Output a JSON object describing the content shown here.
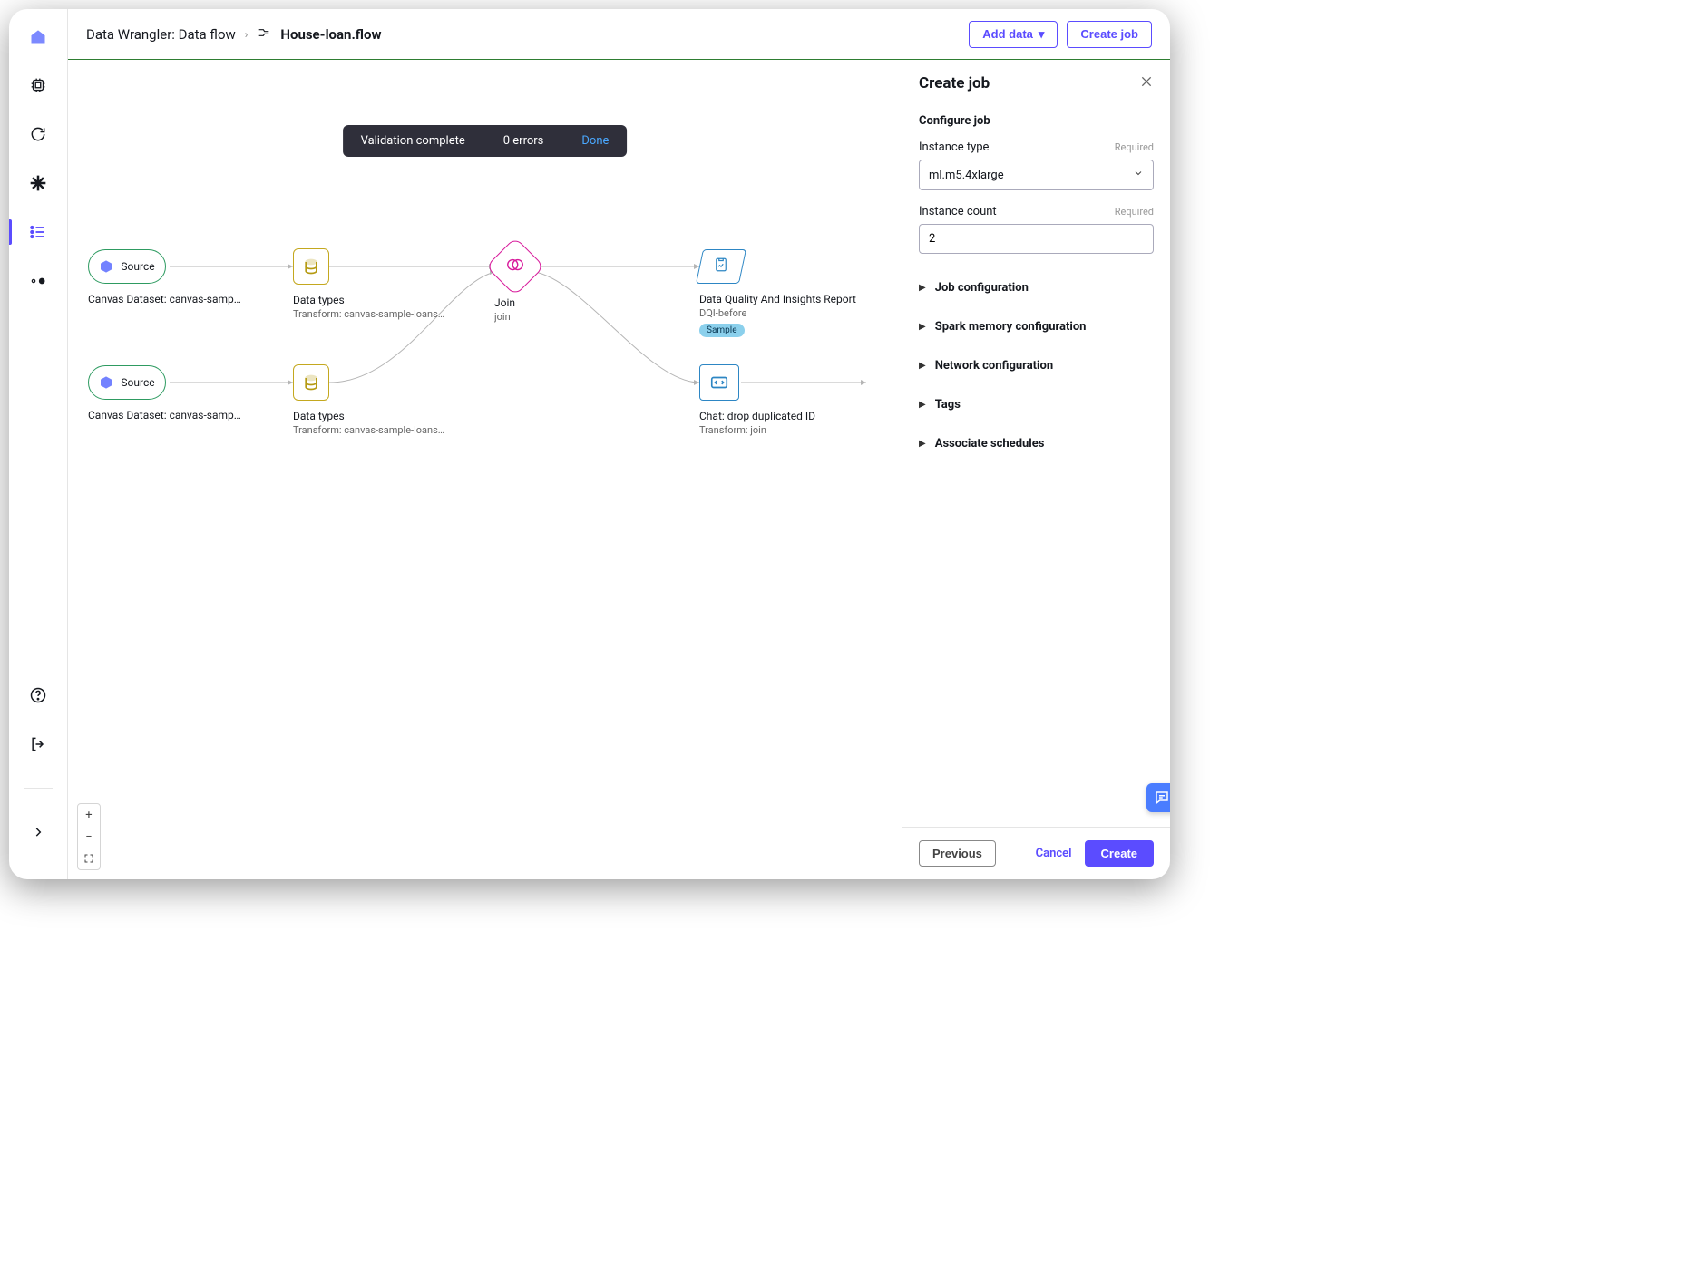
{
  "breadcrumb": {
    "root": "Data Wrangler: Data flow",
    "file": "House-loan.flow"
  },
  "topbar": {
    "add_data": "Add data",
    "create_job": "Create job"
  },
  "toast": {
    "message": "Validation complete",
    "errors": "0 errors",
    "done": "Done"
  },
  "nodes": {
    "source1": {
      "label": "Source",
      "sub": "Canvas Dataset: canvas-sample-loans-…"
    },
    "source2": {
      "label": "Source",
      "sub": "Canvas Dataset: canvas-sample-loans-…"
    },
    "types1": {
      "title": "Data types",
      "sub": "Transform: canvas-sample-loans-part-…"
    },
    "types2": {
      "title": "Data types",
      "sub": "Transform: canvas-sample-loans-part-…"
    },
    "join": {
      "title": "Join",
      "sub": "join"
    },
    "dqi": {
      "title": "Data Quality And Insights Report",
      "sub": "DQI-before",
      "badge": "Sample"
    },
    "chat": {
      "title": "Chat: drop duplicated ID",
      "sub": "Transform: join"
    }
  },
  "zoom": {
    "in": "+",
    "out": "−"
  },
  "panel": {
    "title": "Create job",
    "configure": "Configure job",
    "instance_type": {
      "label": "Instance type",
      "req": "Required",
      "value": "ml.m5.4xlarge"
    },
    "instance_count": {
      "label": "Instance count",
      "req": "Required",
      "value": "2"
    },
    "accordion": {
      "job_config": "Job configuration",
      "spark": "Spark memory configuration",
      "network": "Network configuration",
      "tags": "Tags",
      "schedules": "Associate schedules"
    },
    "footer": {
      "previous": "Previous",
      "cancel": "Cancel",
      "create": "Create"
    }
  }
}
